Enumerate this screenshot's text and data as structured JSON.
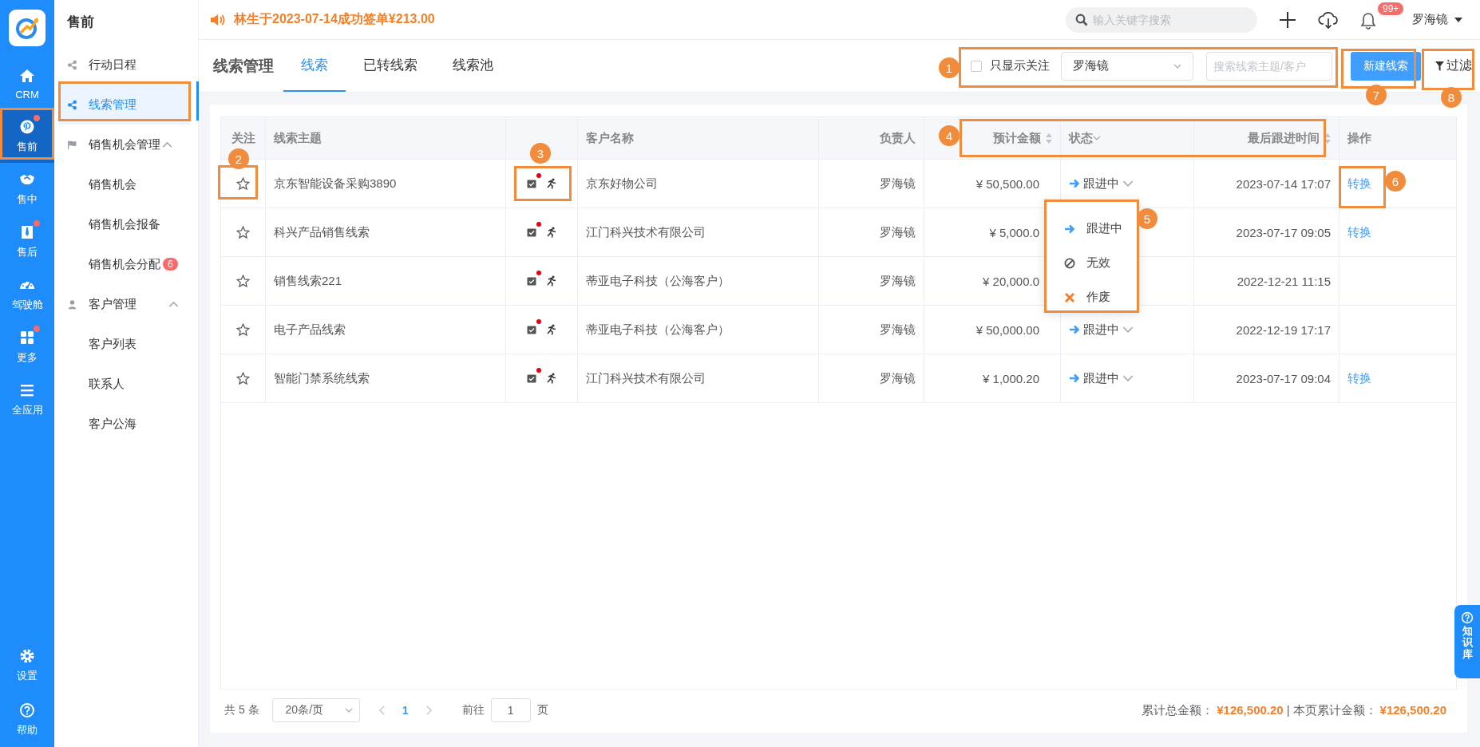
{
  "rail": {
    "items": [
      {
        "label": "CRM",
        "selected": false,
        "dot": false
      },
      {
        "label": "售前",
        "selected": true,
        "dot": true
      },
      {
        "label": "售中",
        "selected": false,
        "dot": false
      },
      {
        "label": "售后",
        "selected": false,
        "dot": true
      },
      {
        "label": "驾驶舱",
        "selected": false,
        "dot": false
      },
      {
        "label": "更多",
        "selected": false,
        "dot": true
      },
      {
        "label": "全应用",
        "selected": false,
        "dot": false
      }
    ],
    "bottom": [
      {
        "label": "设置"
      },
      {
        "label": "帮助"
      }
    ]
  },
  "submenu": {
    "title": "售前",
    "items": [
      {
        "label": "行动日程",
        "selected": false
      },
      {
        "label": "线索管理",
        "selected": true
      },
      {
        "label": "销售机会管理",
        "expanded": true,
        "children": [
          {
            "label": "销售机会",
            "selected": false
          },
          {
            "label": "销售机会报备",
            "selected": false
          },
          {
            "label": "销售机会分配",
            "selected": false,
            "badge": "6"
          }
        ]
      },
      {
        "label": "客户管理",
        "expanded": true,
        "children": [
          {
            "label": "客户列表",
            "selected": false
          },
          {
            "label": "联系人",
            "selected": false
          },
          {
            "label": "客户公海",
            "selected": false
          }
        ]
      }
    ]
  },
  "notice": "林生于2023-07-14成功签单¥213.00",
  "topbar": {
    "search_placeholder": "输入关键字搜索",
    "bell_badge": "99+",
    "user": "罗海镜"
  },
  "page_title": "线索管理",
  "tabs": [
    {
      "label": "线索",
      "selected": true
    },
    {
      "label": "已转线索",
      "selected": false
    },
    {
      "label": "线索池",
      "selected": false
    }
  ],
  "toolbar": {
    "only_followed": {
      "label": "只显示关注",
      "checked": false
    },
    "owner_select": "罗海镜",
    "search_placeholder": "搜索线索主题/客户",
    "new_button": "新建线索",
    "filter": "过滤"
  },
  "table": {
    "columns": [
      "关注",
      "线索主题",
      "",
      "客户名称",
      "负责人",
      "预计金额",
      "状态",
      "最后跟进时间",
      "操作"
    ],
    "rows": [
      {
        "followed": false,
        "subject": "京东智能设备采购3890",
        "customer": "京东好物公司",
        "owner": "罗海镜",
        "amount": "¥ 50,500.00",
        "status": "跟进中",
        "last_follow": "2023-07-14 17:07",
        "action": "转换"
      },
      {
        "followed": false,
        "subject": "科兴产品销售线索",
        "customer": "江门科兴技术有限公司",
        "owner": "罗海镜",
        "amount": "¥ 5,000.0",
        "last_follow": "2023-07-17 09:05",
        "action": "转换"
      },
      {
        "followed": false,
        "subject": "销售线索221",
        "customer": "蒂亚电子科技（公海客户）",
        "owner": "罗海镜",
        "amount": "¥ 20,000.0",
        "last_follow": "2022-12-21 11:15"
      },
      {
        "followed": false,
        "subject": "电子产品线索",
        "customer": "蒂亚电子科技（公海客户）",
        "owner": "罗海镜",
        "amount": "¥ 50,000.00",
        "status": "跟进中",
        "last_follow": "2022-12-19 17:17"
      },
      {
        "followed": false,
        "subject": "智能门禁系统线索",
        "customer": "江门科兴技术有限公司",
        "owner": "罗海镜",
        "amount": "¥ 1,000.20",
        "status": "跟进中",
        "last_follow": "2023-07-17 09:04",
        "action": "转换"
      }
    ]
  },
  "status_menu": [
    {
      "kind": "follow",
      "label": "跟进中"
    },
    {
      "kind": "invalid",
      "label": "无效"
    },
    {
      "kind": "void",
      "label": "作废"
    }
  ],
  "pagination": {
    "total": "共 5 条",
    "page_size": "20条/页",
    "pages": [
      {
        "label": "1",
        "selected": true
      }
    ],
    "goto_label": "前往",
    "goto_value": "1",
    "page_unit": "页"
  },
  "sums": {
    "total_label": "累计总金额：",
    "total": "¥126,500.20",
    "separator": "|",
    "page_label": "本页累计金额：",
    "page_total": "¥126,500.20"
  },
  "help_tab": "知识库",
  "markers": [
    "1",
    "2",
    "3",
    "4",
    "5",
    "6",
    "7",
    "8"
  ]
}
